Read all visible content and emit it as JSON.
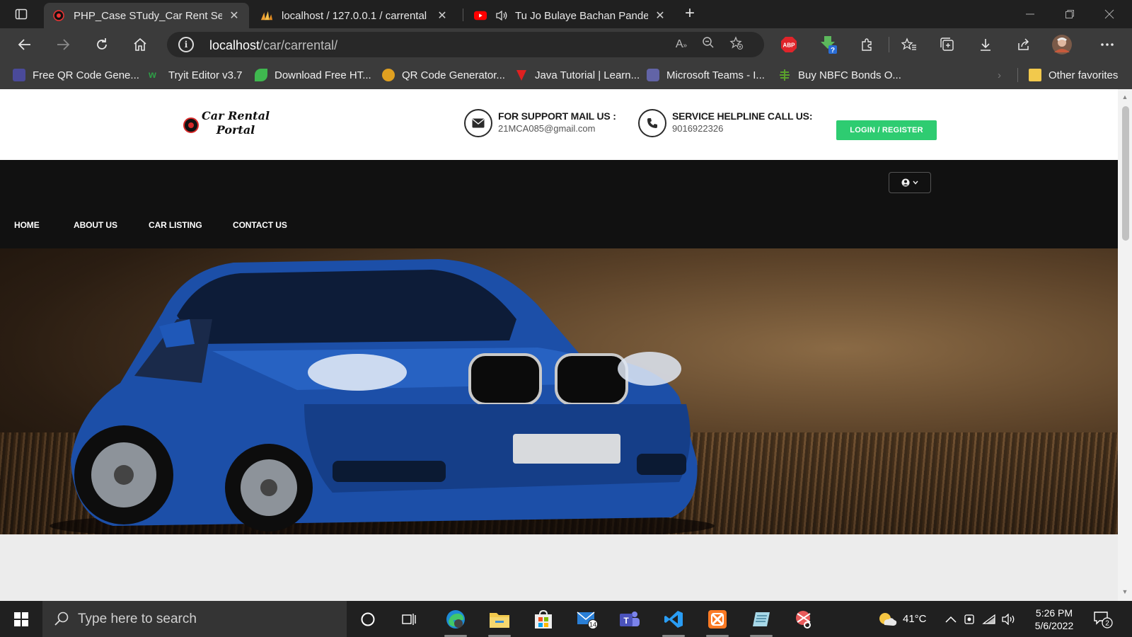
{
  "browser": {
    "tabs": [
      {
        "title": "PHP_Case STudy_Car Rent Servic",
        "active": true,
        "icon": "car-rental-favicon"
      },
      {
        "title": "localhost / 127.0.0.1 / carrental |",
        "active": false,
        "icon": "phpmyadmin-favicon"
      },
      {
        "title": "Tu Jo Bulaye Bachan Pandey",
        "active": false,
        "icon": "youtube-favicon"
      }
    ],
    "address": {
      "host": "localhost",
      "path": "/car/carrental/"
    },
    "bookmarks": [
      {
        "label": "Free QR Code Gene...",
        "color": "#4a4a9a"
      },
      {
        "label": "Tryit Editor v3.7",
        "color": "#2e9d46"
      },
      {
        "label": "Download Free HT...",
        "color": "#3fb84f"
      },
      {
        "label": "QR Code Generator...",
        "color": "#e0a020"
      },
      {
        "label": "Java Tutorial | Learn...",
        "color": "#e02020"
      },
      {
        "label": "Microsoft Teams - I...",
        "color": "#6264a7"
      },
      {
        "label": "Buy NBFC Bonds O...",
        "color": "#5aa02c"
      }
    ],
    "other_favorites": "Other favorites",
    "extension_abp": "ABP",
    "extension_badge": "?"
  },
  "site": {
    "logo_line1": "Car Rental",
    "logo_line2": "Portal",
    "support_title": "FOR SUPPORT MAIL US :",
    "support_value": "21MCA085@gmail.com",
    "helpline_title": "SERVICE HELPLINE CALL US:",
    "helpline_value": "9016922326",
    "login_label": "LOGIN / REGISTER",
    "nav": [
      "HOME",
      "ABOUT US",
      "CAR LISTING",
      "CONTACT US"
    ],
    "accent": "#2ecc71"
  },
  "taskbar": {
    "search_placeholder": "Type here to search",
    "mail_badge": "14",
    "weather": "41°C",
    "time": "5:26 PM",
    "date": "5/6/2022",
    "notifications": "2"
  }
}
